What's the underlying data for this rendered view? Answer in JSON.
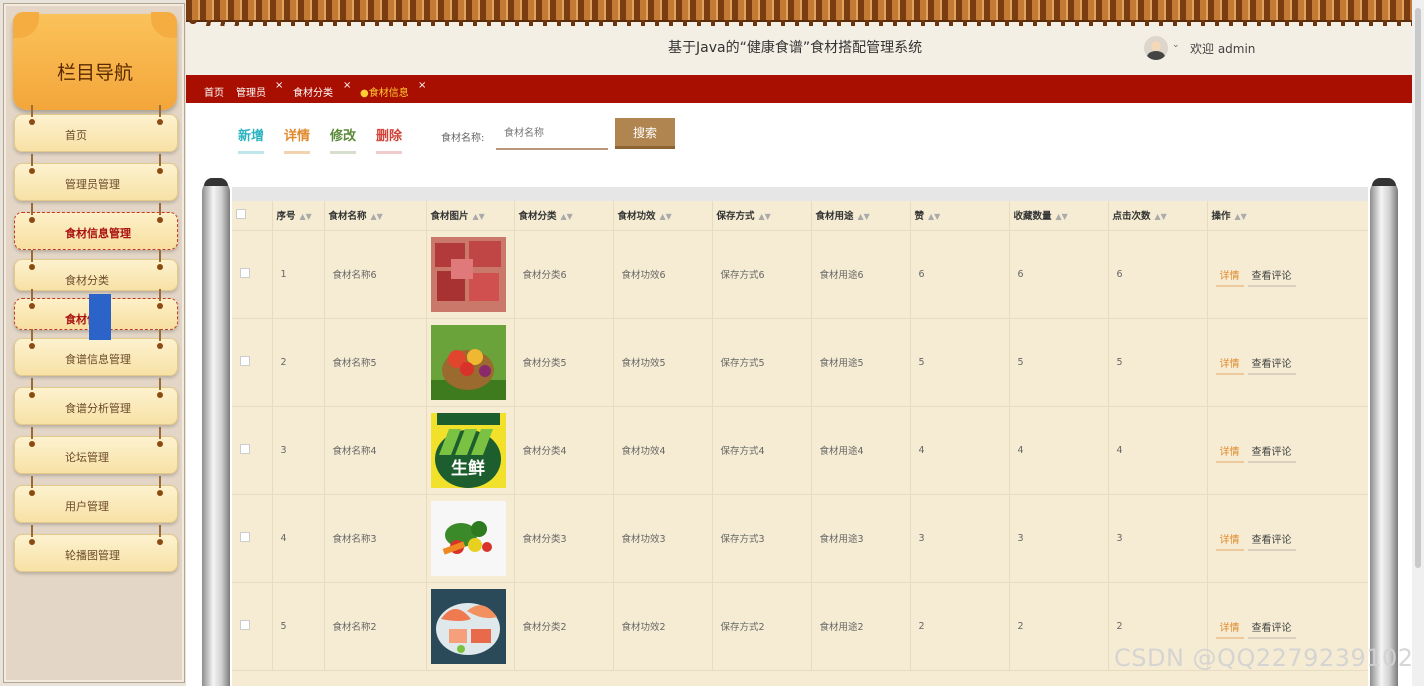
{
  "sidebar": {
    "title": "栏目导航",
    "items": [
      {
        "label": "首页"
      },
      {
        "label": "管理员管理"
      },
      {
        "label": "食材信息管理"
      },
      {
        "label": "食材分类"
      },
      {
        "label": "食材信息"
      },
      {
        "label": "食谱信息管理"
      },
      {
        "label": "食谱分析管理"
      },
      {
        "label": "论坛管理"
      },
      {
        "label": "用户管理"
      },
      {
        "label": "轮播图管理"
      }
    ]
  },
  "header": {
    "title": "基于Java的“健康食谱”食材搭配管理系统",
    "welcome": "欢迎 admin"
  },
  "breadcrumbs": [
    {
      "label": "首页"
    },
    {
      "label": "管理员"
    },
    {
      "label": "食材分类"
    },
    {
      "label": "●食材信息"
    }
  ],
  "toolbar": {
    "add": "新增",
    "detail": "详情",
    "edit": "修改",
    "delete": "删除",
    "search_label": "食材名称:",
    "search_placeholder": "食材名称",
    "search_button": "搜索"
  },
  "table": {
    "headers": [
      "序号",
      "食材名称",
      "食材图片",
      "食材分类",
      "食材功效",
      "保存方式",
      "食材用途",
      "赞",
      "收藏数量",
      "点击次数",
      "操作"
    ],
    "rows": [
      {
        "no": "1",
        "name": "食材名称6",
        "category": "食材分类6",
        "effect": "食材功效6",
        "storage": "保存方式6",
        "usage": "食材用途6",
        "likes": "6",
        "favorites": "6",
        "clicks": "6",
        "image": "meat"
      },
      {
        "no": "2",
        "name": "食材名称5",
        "category": "食材分类5",
        "effect": "食材功效5",
        "storage": "保存方式5",
        "usage": "食材用途5",
        "likes": "5",
        "favorites": "5",
        "clicks": "5",
        "image": "fruit-basket"
      },
      {
        "no": "3",
        "name": "食材名称4",
        "category": "食材分类4",
        "effect": "食材功效4",
        "storage": "保存方式4",
        "usage": "食材用途4",
        "likes": "4",
        "favorites": "4",
        "clicks": "4",
        "image": "fresh-logo"
      },
      {
        "no": "4",
        "name": "食材名称3",
        "category": "食材分类3",
        "effect": "食材功效3",
        "storage": "保存方式3",
        "usage": "食材用途3",
        "likes": "3",
        "favorites": "3",
        "clicks": "3",
        "image": "vegetables"
      },
      {
        "no": "5",
        "name": "食材名称2",
        "category": "食材分类2",
        "effect": "食材功效2",
        "storage": "保存方式2",
        "usage": "食材用途2",
        "likes": "2",
        "favorites": "2",
        "clicks": "2",
        "image": "seafood"
      }
    ],
    "action_detail": "详情",
    "action_comment": "查看评论",
    "fresh_logo_text": "生鲜"
  },
  "watermark": "CSDN @QQ2279239102",
  "colors": {
    "accent_red": "#a90f00",
    "active_crumb": "#ffcc33",
    "add": "#2bb3c0",
    "detail": "#e08a2e",
    "edit": "#5a8a3a",
    "delete": "#d0443a",
    "search_button": "#b08550"
  }
}
